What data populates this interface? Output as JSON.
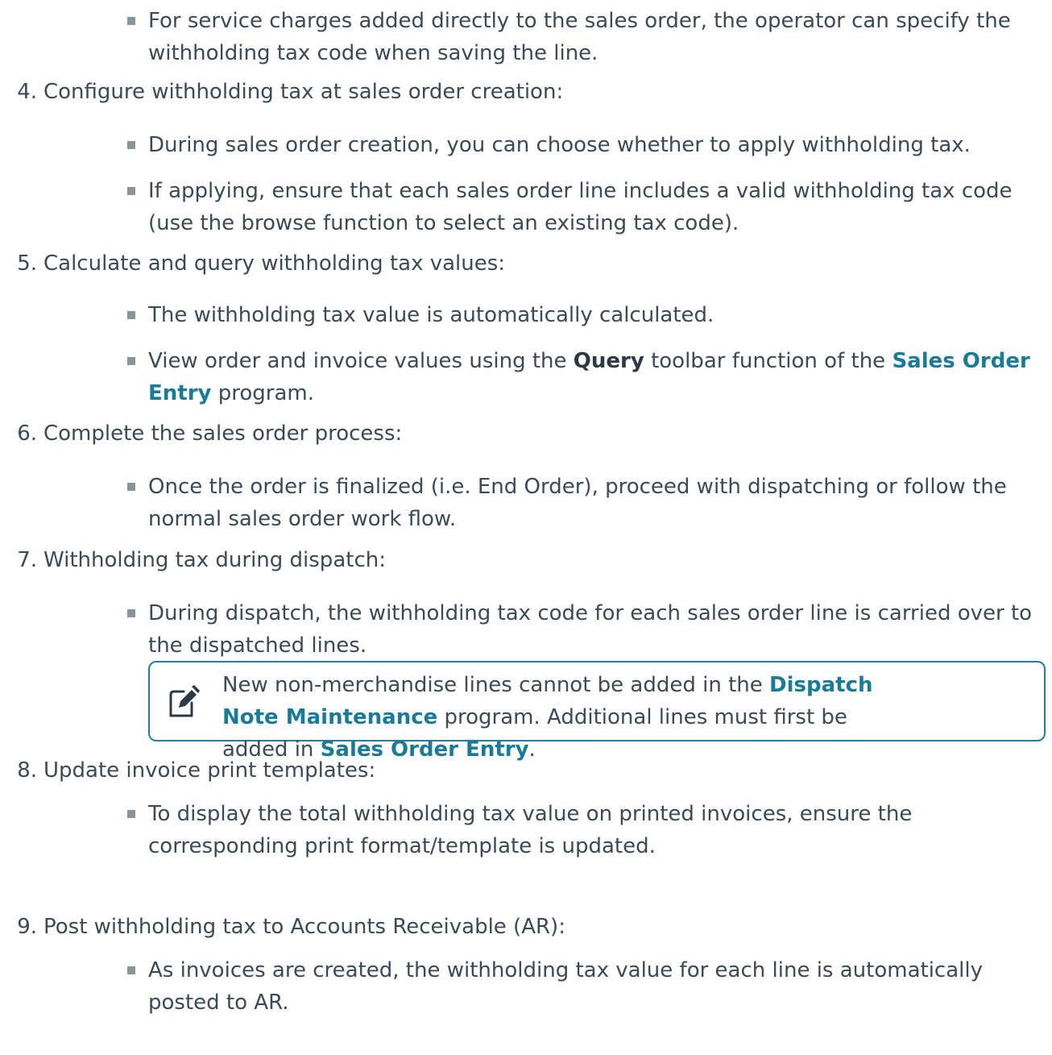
{
  "top_bullet": {
    "text": "For service charges added directly to the sales order, the operator can specify the withholding tax code when saving the line."
  },
  "steps": [
    {
      "num": "4.",
      "title": "Configure withholding tax at sales order creation:",
      "bullets": [
        "During sales order creation, you can choose whether to apply withholding tax.",
        "If applying, ensure that each sales order line includes a valid withholding tax code (use the browse function to select an existing tax code)."
      ]
    },
    {
      "num": "5.",
      "title": "Calculate and query withholding tax values:",
      "bullets": [
        "The withholding tax value is automatically calculated."
      ],
      "rich_bullet": {
        "pre": "View order and invoice values using the ",
        "bold1": "Query",
        "mid": " toolbar function of the ",
        "link1": "Sales Order Entry",
        "post": " program."
      }
    },
    {
      "num": "6.",
      "title": "Complete the sales order process:",
      "bullets": [
        "Once the order is finalized (i.e. End Order), proceed with dispatching or follow the normal sales order work flow."
      ]
    },
    {
      "num": "7.",
      "title": "Withholding tax during dispatch:",
      "bullets": [
        "During dispatch, the withholding tax code for each sales order line is carried over to the dispatched lines."
      ]
    },
    {
      "num": "8.",
      "title": "Update invoice print templates:",
      "bullets": [
        "To display the total withholding tax value on printed invoices, ensure the corresponding print format/template is updated."
      ]
    },
    {
      "num": "9.",
      "title": "Post withholding tax to Accounts Receivable (AR):",
      "bullets": [
        "As invoices are created, the withholding tax value for each line is automatically posted to AR."
      ]
    }
  ],
  "note": {
    "icon": "note-pencil-icon",
    "pre": "New non-merchandise lines cannot be added in the ",
    "link1": "Dispatch Note Maintenance",
    "mid": " program. Additional lines must first be added in ",
    "link2": "Sales Order Entry",
    "post": "."
  },
  "colors": {
    "text": "#3b4a56",
    "link": "#1a7a99",
    "note_border": "#2a7d9a",
    "bullet": "#8a949c"
  }
}
